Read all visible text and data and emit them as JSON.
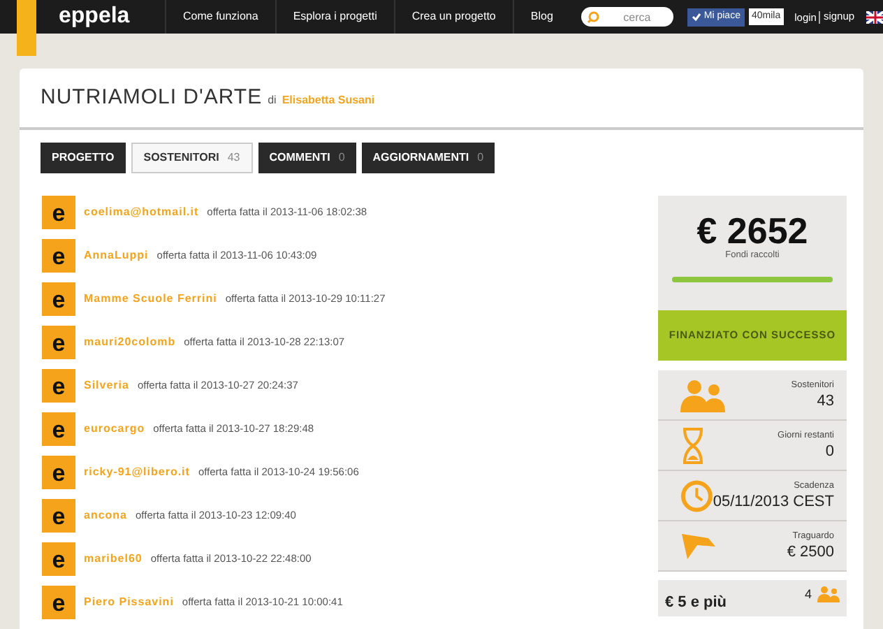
{
  "nav": {
    "logo": "eppela",
    "links": [
      "Come funziona",
      "Esplora i progetti",
      "Crea un progetto",
      "Blog"
    ],
    "search": {
      "placeholder": "cerca"
    },
    "like": {
      "label": "Mi piace",
      "count": "40mila"
    },
    "login": "login",
    "signup": "signup"
  },
  "project": {
    "title": "NUTRIAMOLI D'ARTE",
    "by": "di",
    "author": "Elisabetta Susani"
  },
  "tabs": [
    {
      "label": "PROGETTO",
      "selected": false
    },
    {
      "label": "SOSTENITORI",
      "count": "43",
      "selected": true
    },
    {
      "label": "COMMENTI",
      "count": "0",
      "selected": false
    },
    {
      "label": "AGGIORNAMENTI",
      "count": "0",
      "selected": false
    }
  ],
  "backers": [
    {
      "avatar": "e",
      "name": "coelima@hotmail.it",
      "text": "offerta fatta il 2013-11-06 18:02:38"
    },
    {
      "avatar": "e",
      "name": "AnnaLuppi",
      "text": "offerta fatta il 2013-11-06 10:43:09"
    },
    {
      "avatar": "e",
      "name": "Mamme Scuole Ferrini",
      "text": "offerta fatta il 2013-10-29 10:11:27"
    },
    {
      "avatar": "e",
      "name": "mauri20colomb",
      "text": "offerta fatta il 2013-10-28 22:13:07"
    },
    {
      "avatar": "e",
      "name": "Silveria",
      "text": "offerta fatta il 2013-10-27 20:24:37"
    },
    {
      "avatar": "e",
      "name": "eurocargo",
      "text": "offerta fatta il 2013-10-27 18:29:48"
    },
    {
      "avatar": "e",
      "name": "ricky-91@libero.it",
      "text": "offerta fatta il 2013-10-24 19:56:06"
    },
    {
      "avatar": "e",
      "name": "ancona",
      "text": "offerta fatta il 2013-10-23 12:09:40"
    },
    {
      "avatar": "e",
      "name": "maribel60",
      "text": "offerta fatta il 2013-10-22 22:48:00"
    },
    {
      "avatar": "e",
      "name": "Piero Pissavini",
      "text": "offerta fatta il 2013-10-21 10:00:41"
    }
  ],
  "funding": {
    "amount": "€ 2652",
    "label": "Fondi raccolti",
    "level": 1,
    "status": "FINANZIATO CON SUCCESSO"
  },
  "stats": [
    {
      "kind": "people",
      "label": "Sostenitori",
      "value": "43"
    },
    {
      "kind": "hourglass",
      "label": "Giorni restanti",
      "value": "0"
    },
    {
      "kind": "clock",
      "label": "Scadenza",
      "value": "05/11/2013 CEST"
    },
    {
      "kind": "flag",
      "label": "Traguardo",
      "value": "€ 2500"
    }
  ],
  "reward": {
    "amount": "€ 5 e più",
    "count": "4"
  }
}
